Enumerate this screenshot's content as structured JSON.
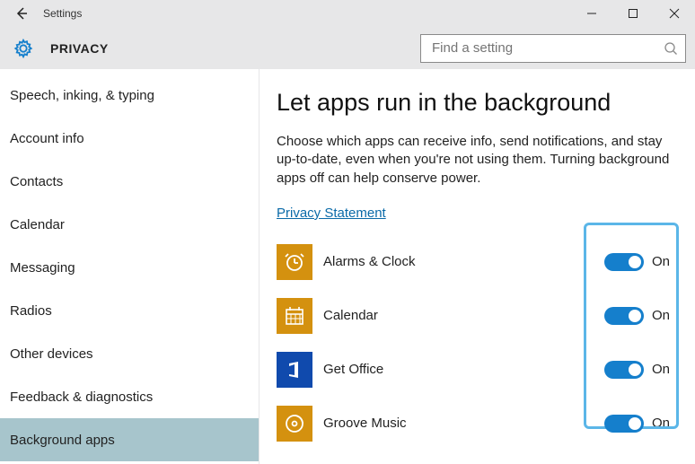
{
  "window": {
    "title": "Settings"
  },
  "header": {
    "category": "PRIVACY"
  },
  "search": {
    "placeholder": "Find a setting"
  },
  "sidebar": {
    "items": [
      {
        "label": "Speech, inking, & typing",
        "active": false
      },
      {
        "label": "Account info",
        "active": false
      },
      {
        "label": "Contacts",
        "active": false
      },
      {
        "label": "Calendar",
        "active": false
      },
      {
        "label": "Messaging",
        "active": false
      },
      {
        "label": "Radios",
        "active": false
      },
      {
        "label": "Other devices",
        "active": false
      },
      {
        "label": "Feedback & diagnostics",
        "active": false
      },
      {
        "label": "Background apps",
        "active": true
      }
    ]
  },
  "page": {
    "title": "Let apps run in the background",
    "description": "Choose which apps can receive info, send notifications, and stay up-to-date, even when you're not using them. Turning background apps off can help conserve power.",
    "privacy_link": "Privacy Statement"
  },
  "apps": [
    {
      "name": "Alarms & Clock",
      "state": "On",
      "iconColor": "orange",
      "iconName": "alarm-clock-icon"
    },
    {
      "name": "Calendar",
      "state": "On",
      "iconColor": "orange",
      "iconName": "calendar-icon"
    },
    {
      "name": "Get Office",
      "state": "On",
      "iconColor": "blue",
      "iconName": "office-icon"
    },
    {
      "name": "Groove Music",
      "state": "On",
      "iconColor": "orange",
      "iconName": "groove-music-icon"
    }
  ],
  "icons": {
    "alarm-clock-icon": "clock",
    "calendar-icon": "calendar",
    "office-icon": "office",
    "groove-music-icon": "disc"
  }
}
